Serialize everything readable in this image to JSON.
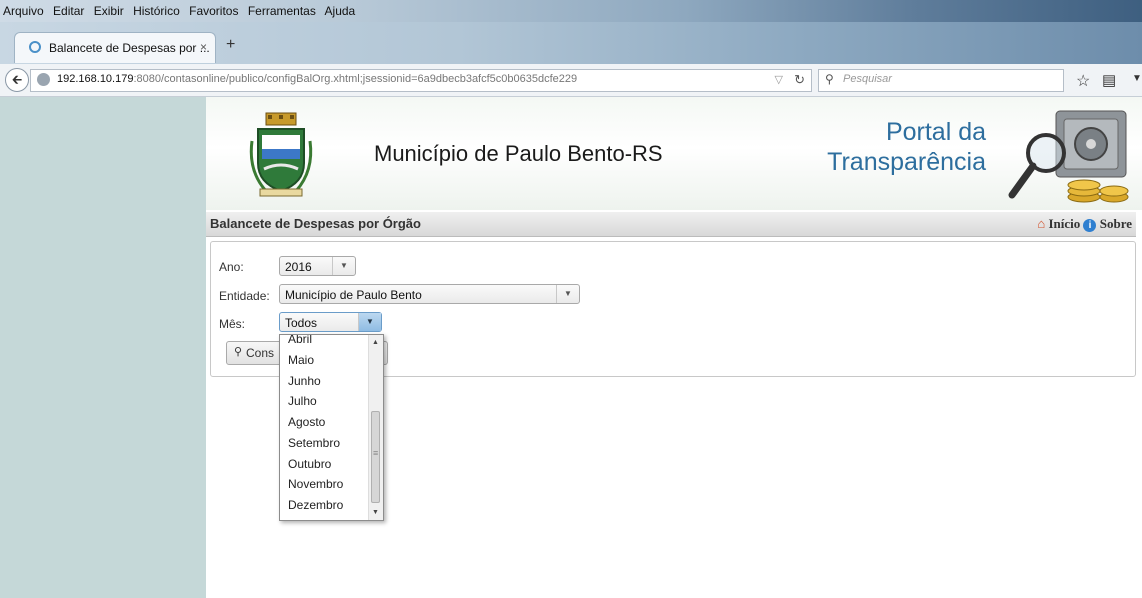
{
  "browser": {
    "menu": [
      "Arquivo",
      "Editar",
      "Exibir",
      "Histórico",
      "Favoritos",
      "Ferramentas",
      "Ajuda"
    ],
    "tab_title": "Balancete de Despesas por ...",
    "tab_close": "×",
    "new_tab": "+",
    "url_host": "192.168.10.179",
    "url_rest": ":8080/contasonline/publico/configBalOrg.xhtml;jsessionid=6a9dbecb3afcf5c0b0635dcfe229",
    "search_placeholder": "Pesquisar",
    "icons": [
      "back-arrow-icon",
      "globe-icon",
      "reload-icon",
      "search-icon",
      "star-icon",
      "bookmarks-icon"
    ]
  },
  "header": {
    "municipality": "Município de Paulo Bento-RS",
    "portal_line1": "Portal da",
    "portal_line2": "Transparência"
  },
  "titlebar": {
    "title": "Balancete de Despesas por Órgão",
    "inicio": "Início",
    "sobre": "Sobre"
  },
  "form": {
    "ano_label": "Ano:",
    "ano_value": "2016",
    "entidade_label": "Entidade:",
    "entidade_value": "Município de Paulo Bento",
    "mes_label": "Mês:",
    "mes_value": "Todos",
    "consultar_label": "Cons"
  },
  "dropdown": {
    "options": [
      "Abril",
      "Maio",
      "Junho",
      "Julho",
      "Agosto",
      "Setembro",
      "Outubro",
      "Novembro",
      "Dezembro"
    ]
  },
  "colors": {
    "accent": "#2d6e9e",
    "left_strip": "#c5d8d8"
  }
}
